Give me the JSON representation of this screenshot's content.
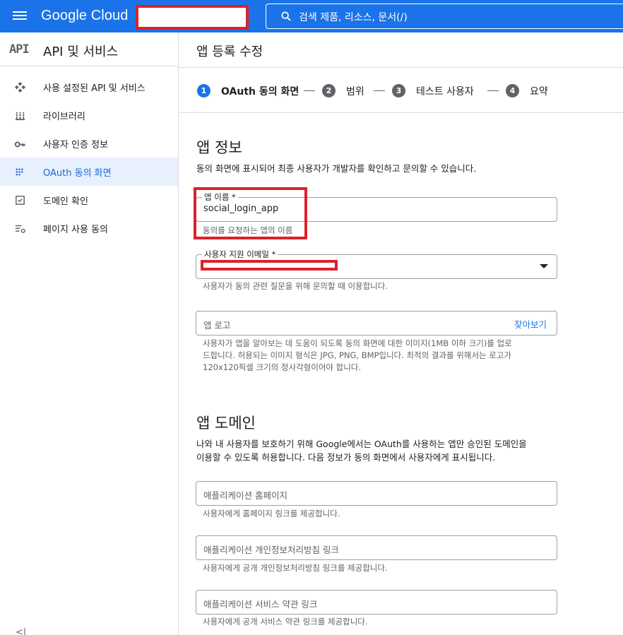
{
  "topbar": {
    "logo": "Google Cloud",
    "search_text": "검색  제품, 리소스, 문서(/)"
  },
  "sidebar": {
    "api_logo": "API",
    "title": "API 및 서비스",
    "items": [
      {
        "label": "사용 설정된 API 및 서비스",
        "icon": "apis-icon"
      },
      {
        "label": "라이브러리",
        "icon": "library-icon"
      },
      {
        "label": "사용자 인증 정보",
        "icon": "key-icon"
      },
      {
        "label": "OAuth 동의 화면",
        "icon": "oauth-consent-icon"
      },
      {
        "label": "도메인 확인",
        "icon": "domain-check-icon"
      },
      {
        "label": "페이지 사용 동의",
        "icon": "page-usage-icon"
      }
    ],
    "collapse": "<|"
  },
  "main": {
    "page_title": "앱 등록 수정",
    "steps": [
      {
        "number": "1",
        "label": "OAuth 동의 화면",
        "active": true
      },
      {
        "number": "2",
        "label": "범위",
        "active": false
      },
      {
        "number": "3",
        "label": "테스트 사용자",
        "active": false
      },
      {
        "number": "4",
        "label": "요약",
        "active": false
      }
    ],
    "app_info": {
      "title": "앱 정보",
      "desc": "동의 화면에 표시되어 최종 사용자가 개발자를 확인하고 문의할 수 있습니다.",
      "app_name_label": "앱 이름 *",
      "app_name_value": "social_login_app",
      "app_name_hint": "동의를 요청하는 앱의 이름",
      "email_label": "사용자 지원 이메일 *",
      "email_hint": "사용자가 동의 관련 질문을 위해 문의할 때 이용합니다.",
      "logo_placeholder": "앱 로고",
      "logo_browse": "찾아보기",
      "logo_hint_1": "사용자가 앱을 알아보는 데 도움이 되도록 동의 화면에 대한 이미지(1MB 이하 크기)를 업로",
      "logo_hint_2": "드합니다. 허용되는 이미지 형식은 JPG, PNG, BMP입니다. 최적의 결과를 위해서는 로고가",
      "logo_hint_3": "120x120픽셀 크기의 정사각형이어야 합니다."
    },
    "app_domain": {
      "title": "앱 도메인",
      "desc_1": "나와 내 사용자를 보호하기 위해 Google에서는 OAuth를 사용하는 앱만 승인된 도메인을",
      "desc_2": "이용할 수 있도록 허용합니다. 다음 정보가 동의 화면에서 사용자에게 표시됩니다.",
      "homepage_placeholder": "애플리케이션 홈페이지",
      "homepage_hint": "사용자에게 홈페이지 링크를 제공합니다.",
      "privacy_placeholder": "애플리케이션 개인정보처리방침 링크",
      "privacy_hint": "사용자에게 공개 개인정보처리방침 링크를 제공합니다.",
      "tos_placeholder": "애플리케이션 서비스 약관 링크",
      "tos_hint": "사용자에게 공개 서비스 약관 링크를 제공합니다."
    }
  },
  "colors": {
    "brand_blue": "#1a73e8",
    "active_step": "#1a73e8",
    "inactive_step": "#5f6368",
    "highlight_red": "#d9232d"
  }
}
